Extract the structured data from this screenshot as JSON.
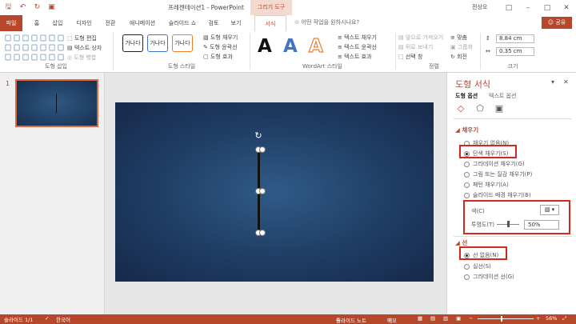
{
  "titlebar": {
    "title": "프레젠테이션1 - PowerPoint",
    "tool_tag": "그리기 도구",
    "user": "전상오",
    "icons": [
      "save-icon",
      "undo-icon",
      "redo-icon",
      "present-icon"
    ]
  },
  "tabs": [
    "파일",
    "홈",
    "삽입",
    "디자인",
    "전환",
    "애니메이션",
    "슬라이드 쇼",
    "검토",
    "보기",
    "서식"
  ],
  "active_tab": "서식",
  "tell_me": "어떤 작업을 원하시나요?",
  "share": "공유",
  "ribbon": {
    "insert_shapes": {
      "label": "도형 삽입",
      "edit_shape": "도형 편집",
      "text_box": "텍스트 상자",
      "merge_shapes": "도형 병합"
    },
    "shape_styles": {
      "label": "도형 스타일",
      "preset": "가나다",
      "fill": "도형 채우기",
      "outline": "도형 윤곽선",
      "effects": "도형 효과"
    },
    "wordart": {
      "label": "WordArt 스타일",
      "letter": "A",
      "text_fill": "텍스트 채우기",
      "text_outline": "텍스트 윤곽선",
      "text_effects": "텍스트 효과"
    },
    "arrange": {
      "label": "정렬",
      "bring_forward": "앞으로 가져오기",
      "send_backward": "뒤로 보내기",
      "selection_pane": "선택 창",
      "align": "맞춤",
      "group": "그룹화",
      "rotate": "회전"
    },
    "size": {
      "label": "크기",
      "height": "8.84 cm",
      "width": "0.35 cm"
    }
  },
  "thumbnails": {
    "slide_number": "1"
  },
  "format_pane": {
    "title": "도형 서식",
    "tab_shape": "도형 옵션",
    "tab_text": "텍스트 옵션",
    "fill_section": "채우기",
    "fill_options": [
      "채우기 없음(N)",
      "단색 채우기(S)",
      "그라데이션 채우기(G)",
      "그림 또는 질감 채우기(P)",
      "패턴 채우기(A)",
      "슬라이드 배경 채우기(B)"
    ],
    "fill_selected": 1,
    "color_label": "색(C)",
    "transparency_label": "투명도(T)",
    "transparency_value": "50%",
    "line_section": "선",
    "line_options": [
      "선 없음(N)",
      "실선(S)",
      "그라데이션 선(G)"
    ],
    "line_selected": 0
  },
  "statusbar": {
    "slide": "슬라이드 1/1",
    "language": "한국어",
    "notes": "슬라이드 노트",
    "memo": "메모",
    "zoom": "56%"
  }
}
